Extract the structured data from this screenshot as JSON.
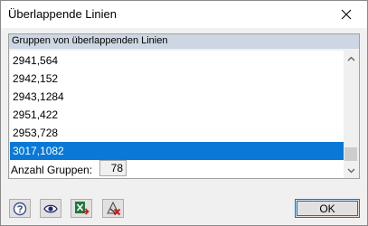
{
  "window": {
    "title": "Überlappende Linien"
  },
  "group": {
    "title": "Gruppen von überlappenden Linien"
  },
  "list": {
    "items": [
      "2941,564",
      "2942,152",
      "2943,1284",
      "2951,422",
      "2953,728",
      "3017,1082"
    ],
    "selected_index": 5
  },
  "count": {
    "label": "Anzahl Gruppen:",
    "value": "78"
  },
  "toolbar": {
    "icons": [
      "help-icon",
      "view-icon",
      "excel-export-icon",
      "delete-overlap-icon"
    ],
    "ok_label": "OK"
  },
  "colors": {
    "selection": "#0a78d7",
    "group_header": "#cdd7e3",
    "accent": "#0078d7"
  }
}
